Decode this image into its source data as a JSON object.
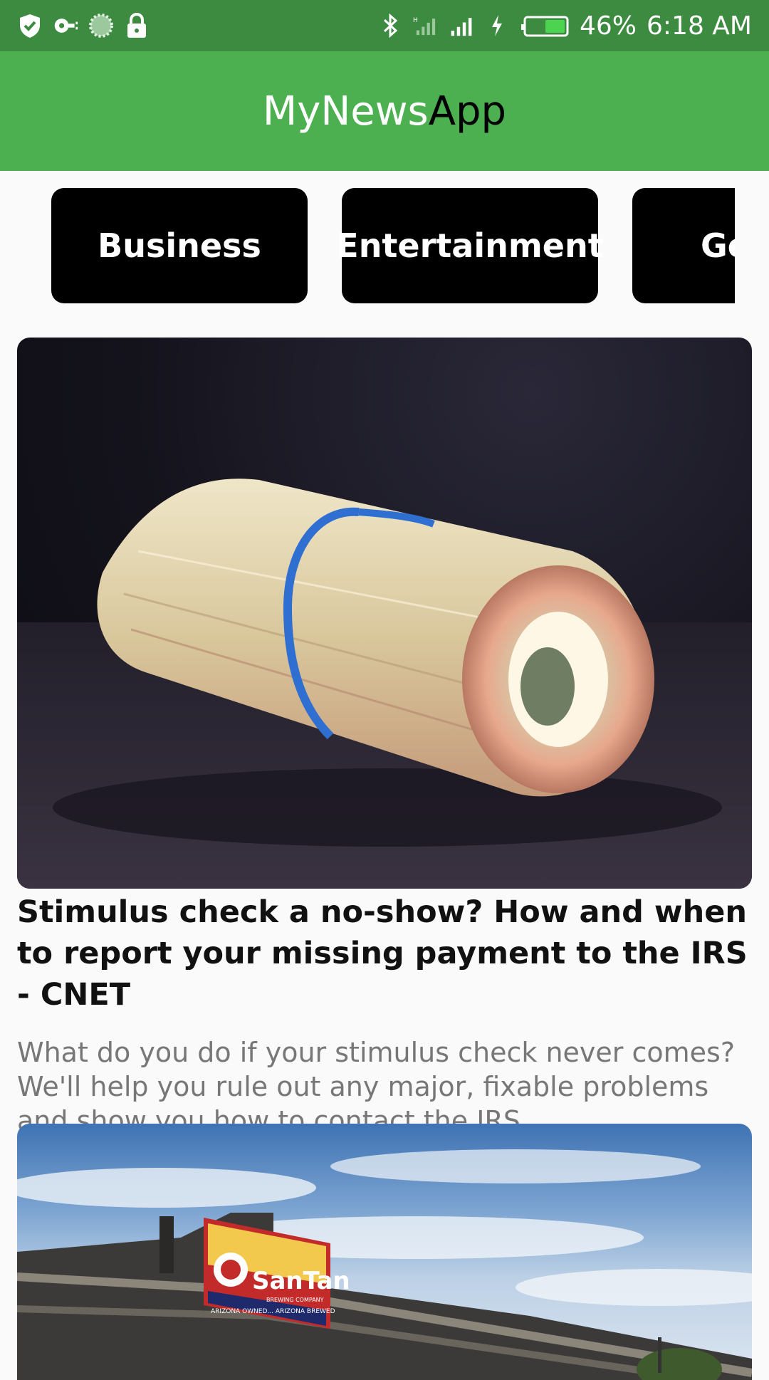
{
  "status_bar": {
    "battery_percent": "46%",
    "time": "6:18 AM",
    "left_icons": [
      "shield-icon",
      "key-icon",
      "loading-icon",
      "lock-icon"
    ],
    "right_icons": [
      "bluetooth-icon",
      "signal-icon",
      "signal-icon",
      "charging-icon",
      "battery-icon"
    ]
  },
  "app_bar": {
    "title_part1": "MyNews",
    "title_part2": "App",
    "background_color": "#4caf50"
  },
  "categories": [
    {
      "label": "Business"
    },
    {
      "label": "Entertainment"
    },
    {
      "label": "Ge"
    }
  ],
  "articles": [
    {
      "image": "rolled-dollar-bills-image",
      "title": "Stimulus check a no-show? How and when to report your missing payment to the IRS - CNET",
      "description": "What do you do if your stimulus check never comes? We'll help you rule out any major, fixable problems and show you how to contact the IRS."
    },
    {
      "image": "santan-brewery-building-image",
      "sign_brand": "SanTan",
      "sign_line1": "BREWING COMPANY",
      "sign_line2": "ARIZONA OWNED... ARIZONA BREWED"
    }
  ]
}
